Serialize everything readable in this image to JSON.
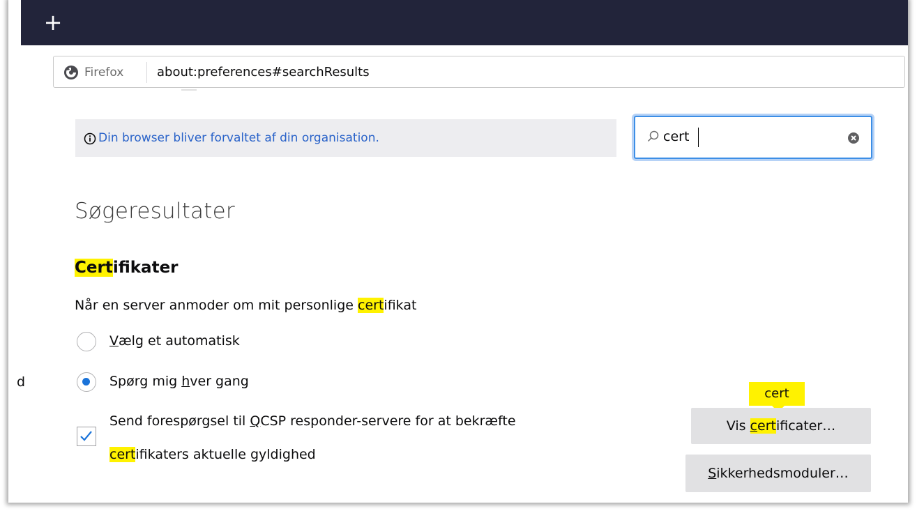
{
  "browser": {
    "new_tab_symbol": "+",
    "url_identity_label": "Firefox",
    "url": "about:preferences#searchResults"
  },
  "notice": {
    "text": "Din browser bliver forvaltet af din organisation."
  },
  "search": {
    "value": "cert"
  },
  "page": {
    "heading": "Søgeresultater"
  },
  "certificates": {
    "title_highlight": "Cert",
    "title_rest": "ifikater",
    "question_pre": "Når en server anmoder om mit personlige ",
    "question_highlight": "cert",
    "question_post": "ifikat",
    "radio_auto_u": "V",
    "radio_auto_rest": "ælg et automatisk",
    "radio_ask_pre": "Spørg mig ",
    "radio_ask_u": "h",
    "radio_ask_post": "ver gang",
    "radio_selected": "ask",
    "side_fragment": "d",
    "ocsp_line1_pre": "Send forespørgsel til ",
    "ocsp_line1_u": "Q",
    "ocsp_line1_post": "CSP responder-servere for at bekræfte",
    "ocsp_line2_highlight": "cert",
    "ocsp_line2_post": "ifikaters aktuelle gyldighed",
    "ocsp_checked": true,
    "tooltip": "cert",
    "btn_view_pre": "Vis ",
    "btn_view_u": "c",
    "btn_view_hl": "ert",
    "btn_view_post": "ificater…",
    "btn_security_u": "S",
    "btn_security_rest": "ikkerhedsmoduler…"
  },
  "colors": {
    "topbar": "#22243a",
    "highlight": "#fff200",
    "link": "#2a63c9",
    "focus": "#3c8ee6",
    "radio_selected": "#1a73d9"
  }
}
